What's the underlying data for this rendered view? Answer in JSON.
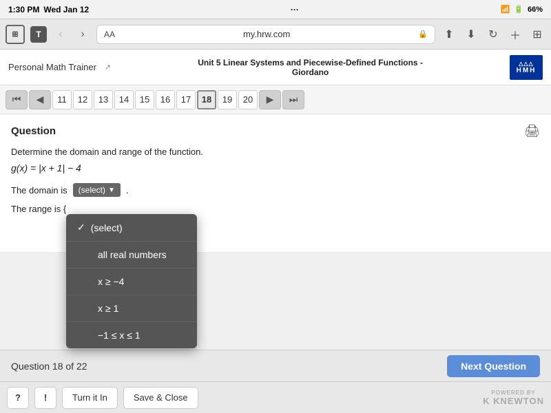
{
  "status_bar": {
    "time": "1:30 PM",
    "day": "Wed Jan 12",
    "dots": "···",
    "battery": "66%"
  },
  "browser": {
    "tab_label": "T",
    "aa_label": "AA",
    "address": "my.hrw.com",
    "lock": "🔒",
    "reload": "↻"
  },
  "app_header": {
    "personal_math_trainer": "Personal Math Trainer",
    "unit_title": "Unit 5 Linear Systems and Piecewise-Defined Functions -",
    "author": "Giordano",
    "hmh_logo_line1": "△△△",
    "hmh_logo_line2": "HMH"
  },
  "pagination": {
    "pages": [
      "11",
      "12",
      "13",
      "14",
      "15",
      "16",
      "17",
      "18",
      "19",
      "20"
    ],
    "active_page": "18"
  },
  "question": {
    "label": "Question",
    "instruction": "Determine the domain and range of the function.",
    "function": "g(x) = |x + 1| − 4",
    "domain_label": "The domain is",
    "range_label": "The range is {",
    "select_placeholder": "(select)"
  },
  "dropdown": {
    "items": [
      {
        "label": "(select)",
        "selected": true
      },
      {
        "label": "all real numbers",
        "selected": false
      },
      {
        "label": "x ≥ −4",
        "selected": false
      },
      {
        "label": "x ≥ 1",
        "selected": false
      },
      {
        "label": "−1 ≤ x ≤ 1",
        "selected": false
      }
    ]
  },
  "bottom_status": {
    "question_count": "Question 18 of 22",
    "next_button": "Next Question"
  },
  "bottom_actions": {
    "question_mark": "?",
    "exclamation": "!",
    "turn_it_in": "Turn it In",
    "save_close": "Save & Close",
    "powered_by": "POWERED BY",
    "knewton": "K KNEWTON"
  }
}
